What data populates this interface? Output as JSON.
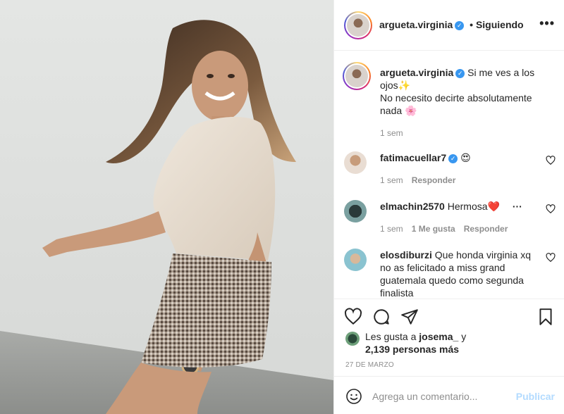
{
  "post": {
    "username": "argueta.virginia",
    "follow_label": "• Siguiendo",
    "more_label": "•••",
    "caption_line1": "Si me ves a los ojos✨",
    "caption_line2": "No necesito decirte absolutamente nada 🌸",
    "caption_time": "1 sem"
  },
  "comments": [
    {
      "username": "fatimacuellar7",
      "verified": true,
      "text": "😍",
      "time": "1 sem",
      "likes": "",
      "reply": "Responder"
    },
    {
      "username": "elmachin2570",
      "verified": false,
      "text": "Hermosa❤️",
      "time": "1 sem",
      "likes": "1 Me gusta",
      "reply": "Responder"
    },
    {
      "username": "elosdiburzi",
      "verified": false,
      "text": "Que honda virginia xq no as felicitado a miss grand guatemala quedo como segunda finalista",
      "time": "",
      "likes": "",
      "reply": ""
    }
  ],
  "likes": {
    "prefix": "Les gusta a",
    "user": "josema_",
    "suffix": "y",
    "count_line": "2,139 personas más"
  },
  "date": "27 DE MARZO",
  "add_comment": {
    "placeholder": "Agrega un comentario...",
    "publish_label": "Publicar"
  },
  "icons": {
    "like": "heart-icon",
    "comment": "comment-icon",
    "share": "share-icon",
    "save": "bookmark-icon",
    "emoji": "emoji-icon",
    "verified": "verified-badge-icon"
  },
  "colors": {
    "verified": "#3897f0",
    "publish_disabled": "#b3dbff",
    "secondary_text": "#8e8e8e"
  }
}
